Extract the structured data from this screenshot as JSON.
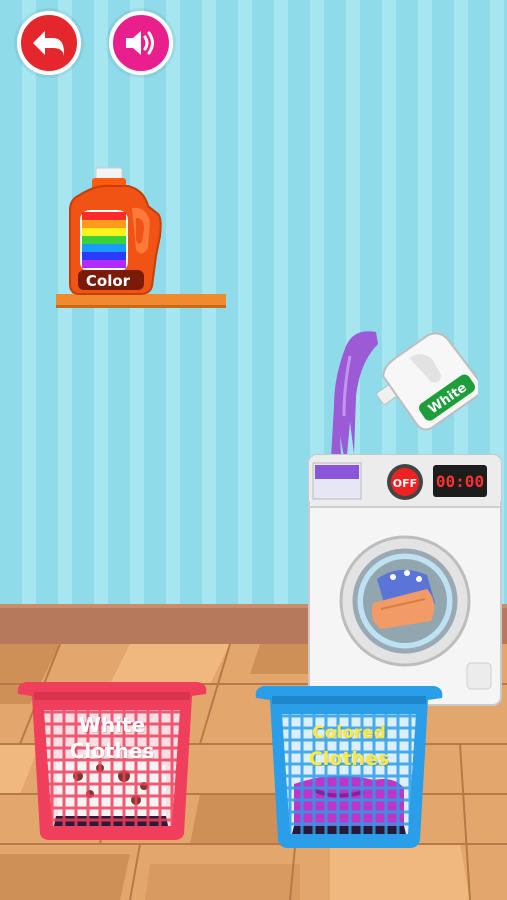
{
  "colors": {
    "wall_stripe_dark": "#8fdbe9",
    "wall_stripe_light": "#a6e6f1",
    "baseboard": "#b7795b",
    "floor": "#e0a36c",
    "back_button": "#e4262d",
    "sound_button": "#e81f8c",
    "shelf": "#ef8a2e",
    "basket_white": "#ef3f5c",
    "basket_colored": "#2a9ee8",
    "detergent_pour": "#9b5ad6"
  },
  "icons": {
    "back": "back-arrow-icon",
    "sound": "speaker-icon"
  },
  "detergent_color": {
    "label": "Color"
  },
  "detergent_white": {
    "label": "White"
  },
  "machine": {
    "power_label": "OFF",
    "timer": "00:00"
  },
  "baskets": {
    "white": {
      "line1": "White",
      "line2": "Clothes"
    },
    "colored": {
      "line1": "Colored",
      "line2": "Clothes"
    }
  }
}
